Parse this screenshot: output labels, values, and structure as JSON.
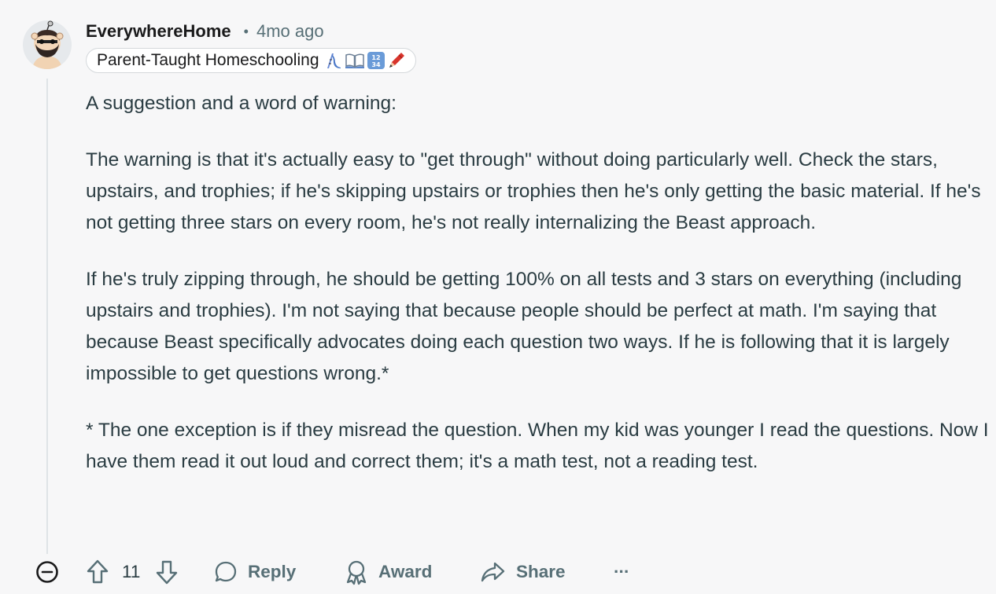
{
  "comment": {
    "username": "EverywhereHome",
    "separator": "•",
    "time": "4mo ago",
    "flair": {
      "text": "Parent-Taught Homeschooling",
      "emoji_icons": [
        "slide-icon",
        "open-book-icon",
        "input-numbers-icon",
        "red-crayon-icon"
      ]
    },
    "paragraphs": [
      "A suggestion and a word of warning:",
      "The warning is that it's actually easy to \"get through\" without doing particularly well. Check the stars, upstairs, and trophies; if he's skipping upstairs or trophies then he's only getting the basic material. If he's not getting three stars on every room, he's not really internalizing the Beast approach.",
      "If he's truly zipping through, he should be getting 100% on all tests and 3 stars on everything (including upstairs and trophies). I'm not saying that because people should be perfect at math. I'm saying that because Beast specifically advocates doing each question two ways. If he is following that it is largely impossible to get questions wrong.*",
      "* The one exception is if they misread the question. When my kid was younger I read the questions. Now I have them read it out loud and correct them; it's a math test, not a reading test."
    ]
  },
  "actions": {
    "vote_count": "11",
    "reply_label": "Reply",
    "award_label": "Award",
    "share_label": "Share",
    "more_label": "···"
  },
  "colors": {
    "background": "#f7f7f8",
    "text": "#2a3c42",
    "muted": "#576f76",
    "thread_line": "#dfe3e6"
  }
}
